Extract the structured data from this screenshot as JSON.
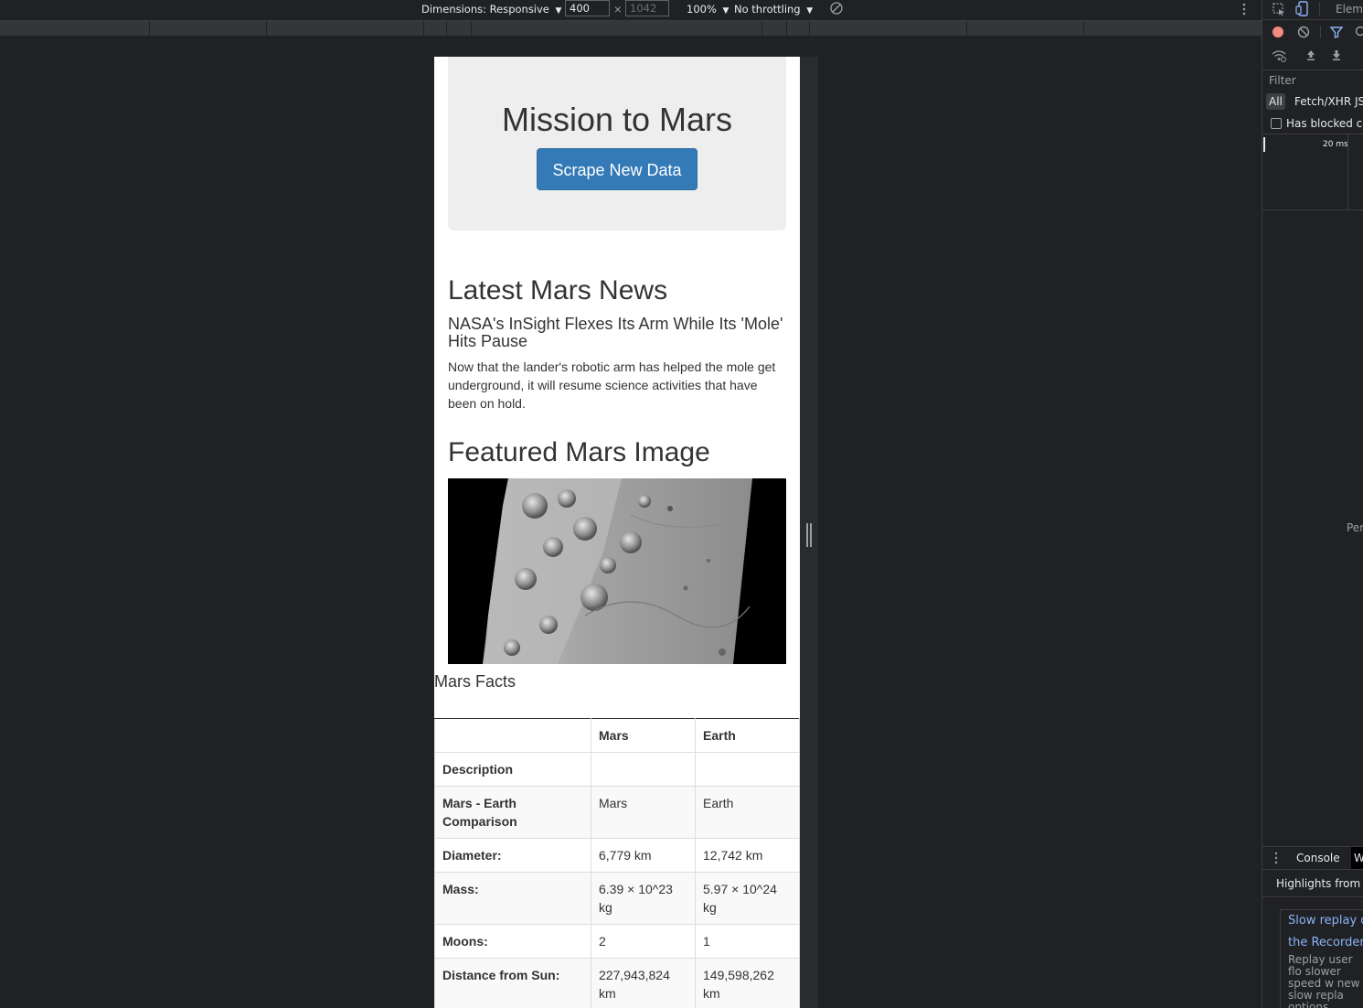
{
  "device_toolbar": {
    "dimensions_label": "Dimensions: Responsive",
    "width_value": "400",
    "times": "×",
    "height_placeholder": "1042",
    "zoom": "100%",
    "throttling": "No throttling",
    "dropdown_arrow": "▼"
  },
  "page": {
    "title": "Mission to Mars",
    "scrape_button": "Scrape New Data",
    "news_heading": "Latest Mars News",
    "news_title": "NASA's InSight Flexes Its Arm While Its 'Mole' Hits Pause",
    "news_body": "Now that the lander's robotic arm has helped the mole get underground, it will resume science activities that have been on hold.",
    "featured_heading": "Featured Mars Image",
    "facts_label": "Mars Facts",
    "facts_table": {
      "headers": [
        "",
        "Mars",
        "Earth"
      ],
      "rows": [
        [
          "Description",
          "",
          ""
        ],
        [
          "Mars - Earth Comparison",
          "Mars",
          "Earth"
        ],
        [
          "Diameter:",
          "6,779 km",
          "12,742 km"
        ],
        [
          "Mass:",
          "6.39 × 10^23 kg",
          "5.97 × 10^24 kg"
        ],
        [
          "Moons:",
          "2",
          "1"
        ],
        [
          "Distance from Sun:",
          "227,943,824 km",
          "149,598,262 km"
        ]
      ]
    }
  },
  "devtools": {
    "tab_elements": "Eleme",
    "filter_label": "Filter",
    "type_all": "All",
    "type_fetch": "Fetch/XHR",
    "type_js": "JS",
    "has_blocked": "Has blocked coo",
    "timeline_tick": "20 ms",
    "side_text": "Per",
    "drawer_console": "Console",
    "drawer_w": "W",
    "highlights": "Highlights from th",
    "tip_link1": "Slow replay o",
    "tip_link2": "the Recorder",
    "tip_body": "Replay user flo slower speed w new slow repla options.",
    "record_color": "#f28b82",
    "accent_color": "#8ab4f8"
  }
}
